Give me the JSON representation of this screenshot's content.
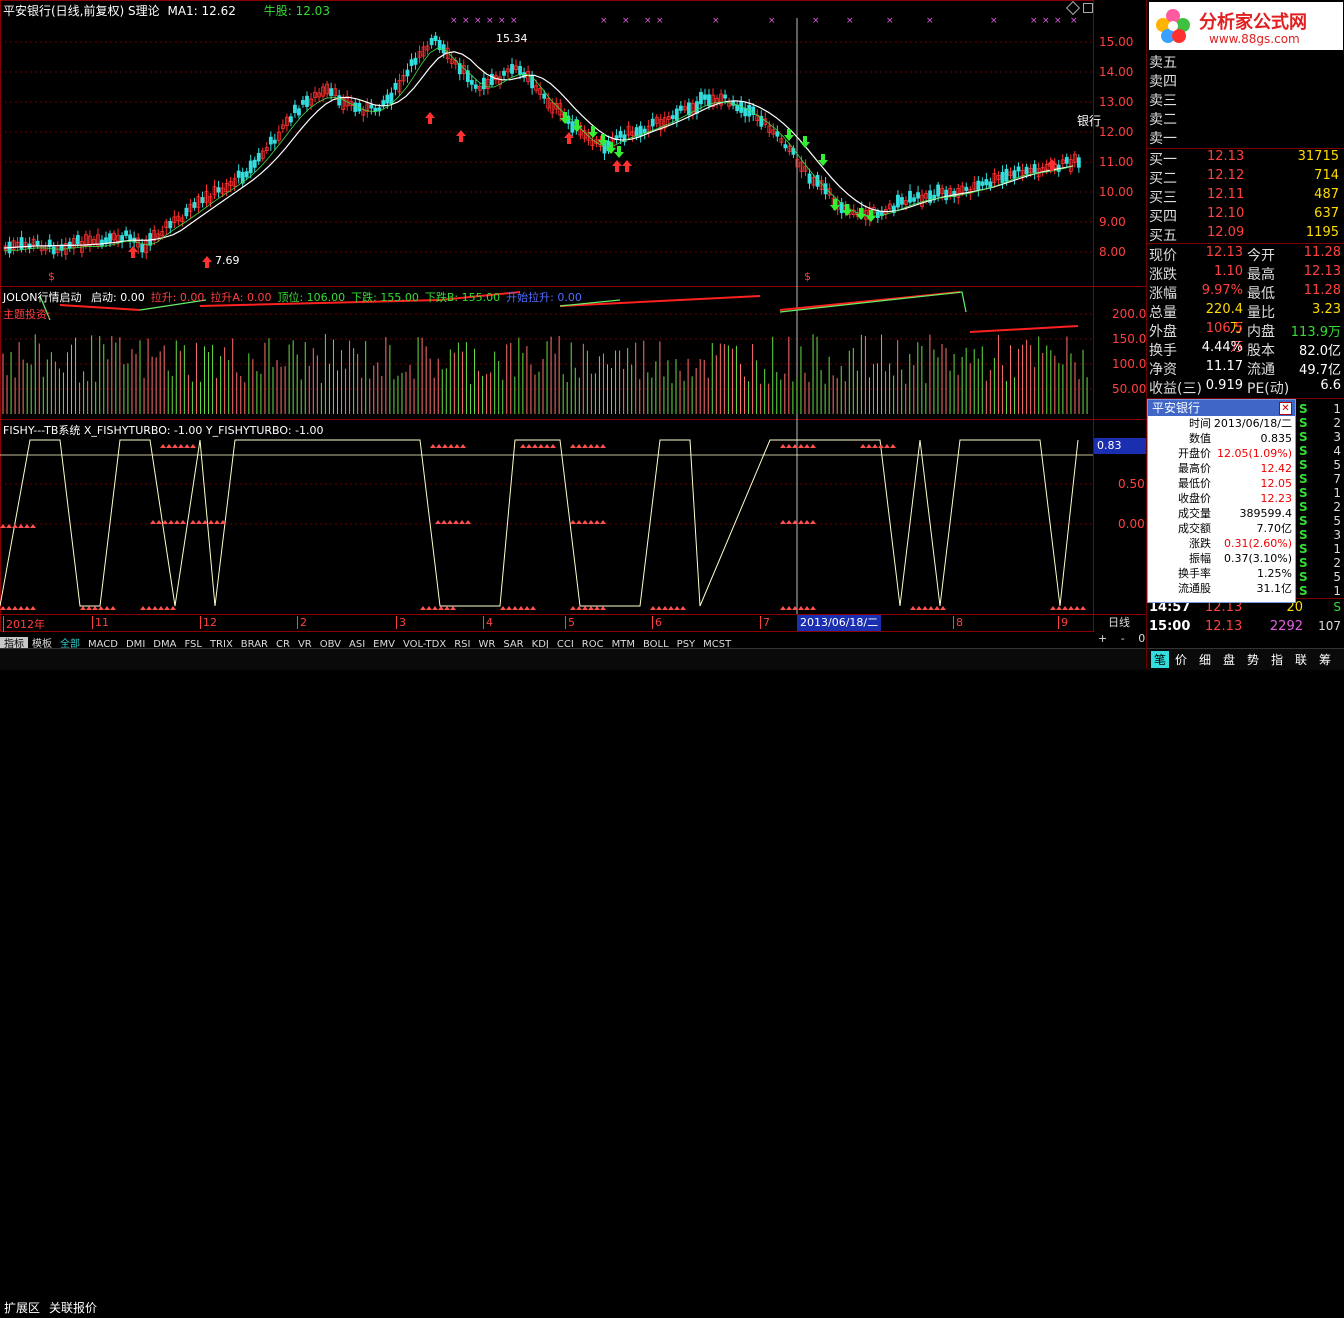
{
  "top_info": {
    "stock_title": "平安银行(日线,前复权)",
    "indicator": "S理论",
    "ma_label": "MA1: 12.62",
    "niu_label": "牛股:",
    "niu_value": "12.03"
  },
  "main_chart": {
    "price_axis": [
      "15.00",
      "14.00",
      "13.00",
      "12.00",
      "11.00",
      "10.00",
      "9.00",
      "8.00"
    ],
    "annotations": {
      "high": "15.34",
      "low": "7.69",
      "bank_tag": "银行",
      "dollar": "$"
    }
  },
  "jolon_panel": {
    "title": "JOLON行情启动",
    "items": [
      {
        "label": "启动: 0.00",
        "color": "#ffffff"
      },
      {
        "label": "拉升: 0.00",
        "color": "#ff4040"
      },
      {
        "label": "拉升A: 0.00",
        "color": "#ff4040"
      },
      {
        "label": "顶位: 106.00",
        "color": "#33dd33"
      },
      {
        "label": "下跌: 155.00",
        "color": "#33dd33"
      },
      {
        "label": "下跌B: 155.00",
        "color": "#33dd33"
      },
      {
        "label": "开始拉升: 0.00",
        "color": "#4f6cff"
      }
    ],
    "subtitle": "主题投资:",
    "axis": [
      "200.0",
      "150.0",
      "100.0",
      "50.00"
    ]
  },
  "fishy_panel": {
    "title": "FISHY---TB系统 X_FISHYTURBO: -1.00 Y_FISHYTURBO: -1.00",
    "axis": [
      "0.83",
      "0.50",
      "0.00"
    ]
  },
  "date_axis": {
    "labels": [
      "2012年",
      "11",
      "12",
      "2",
      "3",
      "4",
      "5",
      "6",
      "7",
      "8",
      "9"
    ],
    "highlight": "2013/06/18/二",
    "period": "日线"
  },
  "indicator_tabs": [
    "指标",
    "模板",
    "全部",
    "MACD",
    "DMI",
    "DMA",
    "FSL",
    "TRIX",
    "BRAR",
    "CR",
    "VR",
    "OBV",
    "ASI",
    "EMV",
    "VOL-TDX",
    "RSI",
    "WR",
    "SAR",
    "KDJ",
    "CCI",
    "ROC",
    "MTM",
    "BOLL",
    "PSY",
    "MCST"
  ],
  "bottom_tabs": [
    "扩展区",
    "关联报价"
  ],
  "zoom_controls": [
    "+",
    "-",
    "0"
  ],
  "logo": {
    "brand": "分析家公式网",
    "url": "www.88gs.com"
  },
  "order_book": {
    "sells_top": [
      "卖五",
      "卖四",
      "卖三",
      "卖二",
      "卖一"
    ],
    "buys": [
      {
        "label": "买一",
        "price": "12.13",
        "vol": "31715"
      },
      {
        "label": "买二",
        "price": "12.12",
        "vol": "714"
      },
      {
        "label": "买三",
        "price": "12.11",
        "vol": "487"
      },
      {
        "label": "买四",
        "price": "12.10",
        "vol": "637"
      },
      {
        "label": "买五",
        "price": "12.09",
        "vol": "1195"
      }
    ]
  },
  "quote": [
    {
      "l1": "现价",
      "v1": "12.13",
      "l2": "今开",
      "v2": "11.28"
    },
    {
      "l1": "涨跌",
      "v1": "1.10",
      "l2": "最高",
      "v2": "12.13"
    },
    {
      "l1": "涨幅",
      "v1": "9.97%",
      "l2": "最低",
      "v2": "11.28"
    },
    {
      "l1": "总量",
      "v1": "220.4万",
      "l2": "量比",
      "v2": "3.23"
    },
    {
      "l1": "外盘",
      "v1": "106.5万",
      "l2": "内盘",
      "v2": "113.9万"
    },
    {
      "l1": "换手",
      "v1": "4.44%",
      "l2": "股本",
      "v2": "82.0亿"
    },
    {
      "l1": "净资",
      "v1": "11.17",
      "l2": "流通",
      "v2": "49.7亿"
    },
    {
      "l1": "收益(三)",
      "v1": "0.919",
      "l2": "PE(动)",
      "v2": "6.6"
    }
  ],
  "popup": {
    "title": "平安银行",
    "rows": [
      {
        "k": "时间",
        "v": "2013/06/18/二",
        "c": "#000"
      },
      {
        "k": "数值",
        "v": "0.835",
        "c": "#000"
      },
      {
        "k": "开盘价",
        "v": "12.05(1.09%)",
        "c": "#e00"
      },
      {
        "k": "最高价",
        "v": "12.42",
        "c": "#e00"
      },
      {
        "k": "最低价",
        "v": "12.05",
        "c": "#e00"
      },
      {
        "k": "收盘价",
        "v": "12.23",
        "c": "#e00"
      },
      {
        "k": "成交量",
        "v": "389599.4",
        "c": "#000"
      },
      {
        "k": "成交额",
        "v": "7.70亿",
        "c": "#000"
      },
      {
        "k": "涨跌",
        "v": "0.31(2.60%)",
        "c": "#e00"
      },
      {
        "k": "振幅",
        "v": "0.37(3.10%)",
        "c": "#000"
      },
      {
        "k": "换手率",
        "v": "1.25%",
        "c": "#000"
      },
      {
        "k": "流通股",
        "v": "31.1亿",
        "c": "#000"
      }
    ]
  },
  "ticks_side": [
    "S",
    "S",
    "S",
    "S",
    "S",
    "S",
    "S",
    "S",
    "S",
    "S",
    "S",
    "S",
    "S",
    "S"
  ],
  "ticks_nums": [
    "1",
    "2",
    "3",
    "4",
    "5",
    "7",
    "1",
    "2",
    "5",
    "3",
    "1",
    "2",
    "5",
    "1"
  ],
  "trades": [
    {
      "time": "14:57",
      "price": "12.13",
      "vol": "20",
      "s": "S"
    },
    {
      "time": "15:00",
      "price": "12.13",
      "vol": "2292",
      "s": "107"
    }
  ],
  "right_tabs": [
    "笔",
    "价",
    "细",
    "盘",
    "势",
    "指",
    "联",
    "筹"
  ]
}
